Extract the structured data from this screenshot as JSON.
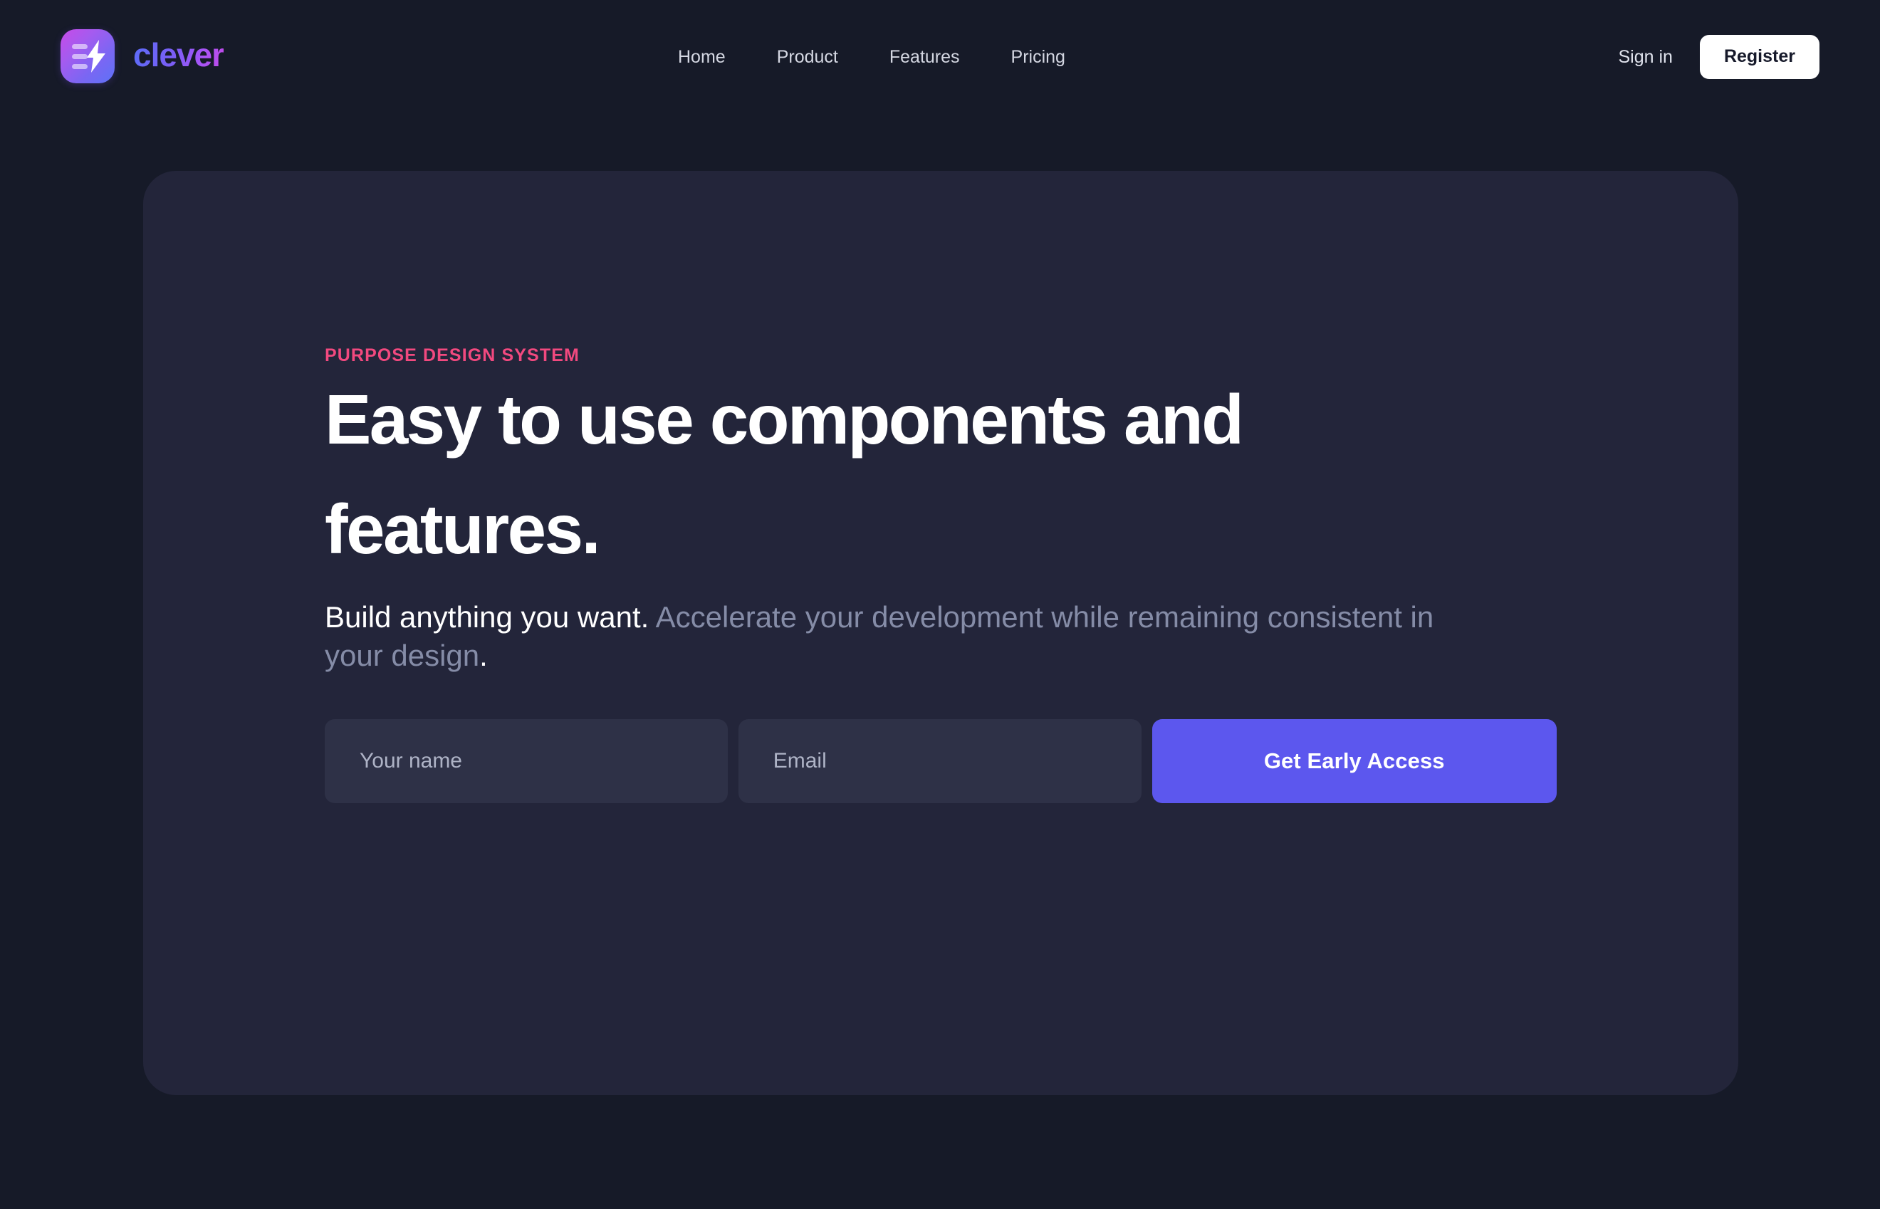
{
  "brand": {
    "name": "clever",
    "logo_icon": "lightning-bolt-list-icon",
    "gradient_from": "#5b6cf8",
    "gradient_to": "#c14ae8"
  },
  "nav": {
    "items": [
      {
        "label": "Home"
      },
      {
        "label": "Product"
      },
      {
        "label": "Features"
      },
      {
        "label": "Pricing"
      }
    ]
  },
  "auth": {
    "signin_label": "Sign in",
    "register_label": "Register"
  },
  "hero": {
    "eyebrow": "PURPOSE DESIGN SYSTEM",
    "eyebrow_color": "#f2497f",
    "headline_line1": "Easy to use components and",
    "headline_line2": "features.",
    "subhead_strong": "Build anything you want.",
    "subhead_muted": " Accelerate your development while remaining consistent in your design",
    "subhead_dot": ".",
    "card_color": "#23253a",
    "page_background": "#161a28"
  },
  "form": {
    "name_placeholder": "Your name",
    "name_value": "",
    "email_placeholder": "Email",
    "email_value": "",
    "cta_label": "Get Early Access",
    "cta_color": "#5c57ee"
  }
}
